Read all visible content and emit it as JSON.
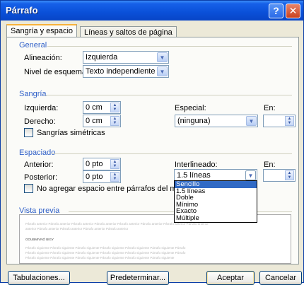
{
  "window": {
    "title": "Párrafo",
    "help_glyph": "?",
    "close_glyph": "✕"
  },
  "tabs": [
    {
      "label": "Sangría y espacio",
      "active": true
    },
    {
      "label": "Líneas y saltos de página",
      "active": false
    }
  ],
  "general": {
    "section_title": "General",
    "alignment_label": "Alineación:",
    "alignment_value": "Izquierda",
    "outline_label": "Nivel de esquema:",
    "outline_value": "Texto independiente"
  },
  "indent": {
    "section_title": "Sangría",
    "left_label": "Izquierda:",
    "left_value": "0 cm",
    "right_label": "Derecho:",
    "right_value": "0 cm",
    "special_label": "Especial:",
    "special_value": "(ninguna)",
    "by_label": "En:",
    "by_value": "",
    "mirror_label": "Sangrías simétricas"
  },
  "spacing": {
    "section_title": "Espaciado",
    "before_label": "Anterior:",
    "before_value": "0 pto",
    "after_label": "Posterior:",
    "after_value": "0 pto",
    "line_spacing_label": "Interlineado:",
    "line_spacing_value": "1.5 líneas",
    "at_label": "En:",
    "at_value": "",
    "no_space_label": "No agregar espacio entre párrafos del mismo e",
    "line_spacing_options": [
      "Sencillo",
      "1.5 líneas",
      "Doble",
      "Mínimo",
      "Exacto",
      "Múltiple"
    ],
    "highlighted_option_index": 0
  },
  "preview": {
    "section_title": "Vista previa",
    "prev_line_1": "Párrafo anterior Párrafo anterior Párrafo anterior Párrafo anterior Párrafo anterior Párrafo anterior Párrafo anterior Párrafo anterior",
    "prev_line_2": "anterior Párrafo anterior Párrafo anterior Párrafo anterior Párrafo anterior",
    "sample_text": "OOUBMIVNÓ BIGY",
    "next_line_1": "Párrafo siguiente Párrafo siguiente Párrafo siguiente Párrafo siguiente Párrafo siguiente Párrafo siguiente Párrafo",
    "next_line_2": "Párrafo siguiente Párrafo siguiente Párrafo siguiente Párrafo siguiente Párrafo siguiente Párrafo siguiente Párrafo",
    "next_line_3": "Párrafo siguiente Párrafo siguiente Párrafo siguiente Párrafo siguiente Párrafo siguiente Párrafo siguiente"
  },
  "buttons": {
    "tabs_label": "Tabulaciones...",
    "default_label": "Predeterminar...",
    "ok_label": "Aceptar",
    "cancel_label": "Cancelar"
  },
  "colors": {
    "titlebar": "#0a50d8",
    "section_title": "#3060c8",
    "selection": "#316ac5"
  }
}
